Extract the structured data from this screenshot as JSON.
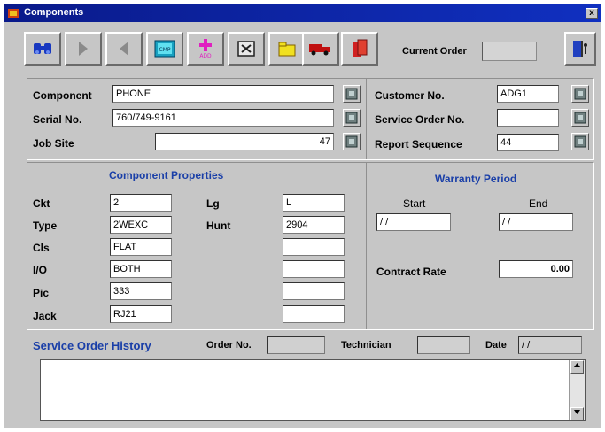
{
  "window": {
    "title": "Components",
    "close_label": "x"
  },
  "toolbar": {
    "buttons": [
      {
        "name": "find-button",
        "icon": "binoculars-icon"
      },
      {
        "name": "next-button",
        "icon": "play-right-icon"
      },
      {
        "name": "previous-button",
        "icon": "play-left-icon"
      },
      {
        "name": "cmp-button",
        "icon": "monitor-icon",
        "label": "CMP"
      },
      {
        "name": "add-button",
        "icon": "add-icon",
        "label": "ADD"
      },
      {
        "name": "delete-button",
        "icon": "delete-box-icon"
      },
      {
        "name": "folder-button",
        "icon": "folder-icon"
      },
      {
        "name": "truck-button",
        "icon": "truck-icon"
      },
      {
        "name": "book-button",
        "icon": "book-icon"
      },
      {
        "name": "exit-button",
        "icon": "exit-door-icon"
      }
    ],
    "current_order_label": "Current Order",
    "current_order_value": ""
  },
  "top": {
    "component_label": "Component",
    "component_value": "PHONE",
    "serial_label": "Serial No.",
    "serial_value": "760/749-9161",
    "jobsite_label": "Job Site",
    "jobsite_value": "47",
    "customer_label": "Customer No.",
    "customer_value": "ADG1",
    "service_order_label": "Service Order No.",
    "service_order_value": "",
    "report_seq_label": "Report Sequence",
    "report_seq_value": "44"
  },
  "props": {
    "title": "Component Properties",
    "ckt_label": "Ckt",
    "ckt_value": "2",
    "type_label": "Type",
    "type_value": "2WEXC",
    "cls_label": "Cls",
    "cls_value": "FLAT",
    "io_label": "I/O",
    "io_value": "BOTH",
    "pic_label": "Pic",
    "pic_value": "333",
    "jack_label": "Jack",
    "jack_value": "RJ21",
    "lg_label": "Lg",
    "lg_value": "L",
    "hunt_label": "Hunt",
    "hunt_value": "2904",
    "extra1_value": "",
    "extra2_value": "",
    "extra3_value": "",
    "extra4_value": ""
  },
  "warranty": {
    "title": "Warranty Period",
    "start_label": "Start",
    "start_value": "/ /",
    "end_label": "End",
    "end_value": "/ /",
    "contract_label": "Contract Rate",
    "contract_value": "0.00"
  },
  "history": {
    "title": "Service Order History",
    "order_label": "Order No.",
    "order_value": "",
    "tech_label": "Technician",
    "tech_value": "",
    "date_label": "Date",
    "date_value": "/ /"
  }
}
